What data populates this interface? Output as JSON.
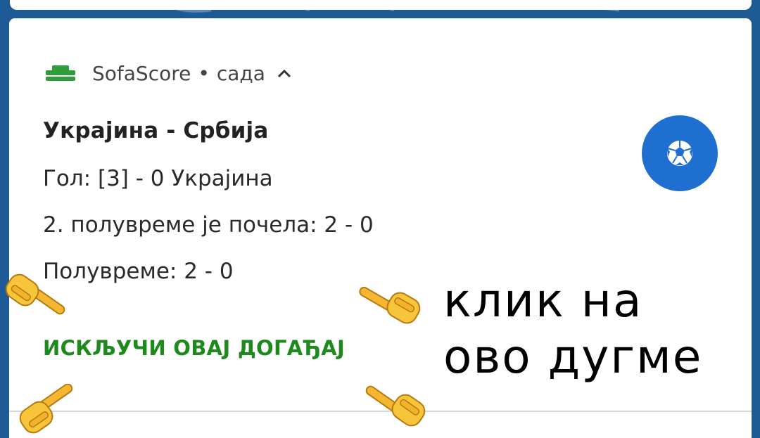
{
  "notification": {
    "app_name": "SofaScore",
    "separator": "•",
    "time": "сада",
    "title": "Украјина - Србија",
    "lines": [
      "Гол: [3] - 0 Украјина",
      "2. полувреме је почела: 2 - 0",
      "Полувреме: 2 - 0"
    ],
    "action_label": "ИСКЉУЧИ ОВАЈ ДОГАЂАЈ"
  },
  "overlay": {
    "caption_line1": "клик на",
    "caption_line2": "ово дугме"
  },
  "icons": {
    "app": "sofascore-logo-icon",
    "expand": "chevron-up-icon",
    "sport": "soccer-ball-icon",
    "pointer": "pointing-hand-emoji"
  },
  "colors": {
    "brand_green": "#2e9e3a",
    "action_green": "#1e8a1e",
    "accent_blue": "#1f6fd0",
    "background": "#1e5a96"
  }
}
